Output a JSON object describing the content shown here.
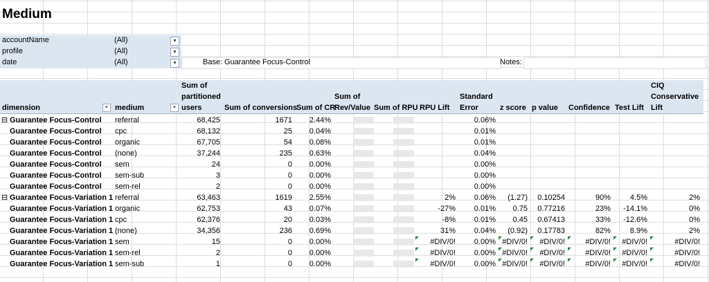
{
  "sheet_title": "Medium",
  "filters": [
    {
      "name": "accountName",
      "value": "(All)"
    },
    {
      "name": "profile",
      "value": "(All)"
    },
    {
      "name": "date",
      "value": "(All)"
    }
  ],
  "base": {
    "label": "Base:",
    "value": "Guarantee Focus-Control"
  },
  "notes": {
    "label": "Notes:"
  },
  "headers": {
    "dimension": "dimension",
    "medium": "medium",
    "users_l1": "Sum of",
    "users_l2": "partitioned",
    "users_l3": "users",
    "conversions": "Sum of conversions",
    "cr": "Sum of CR",
    "rev_l1": "Sum of",
    "rev_l2": "Rev/Value",
    "rpu": "Sum of RPU",
    "rpulift": "RPU Lift",
    "se_l1": "Standard",
    "se_l2": "Error",
    "z": "z score",
    "p": "p value",
    "conf": "Confidence",
    "lift": "Test Lift",
    "ciq_l1": "CIQ",
    "ciq_l2": "Conservative",
    "ciq_l3": "Lift"
  },
  "rows": [
    {
      "dim": "Guarantee Focus-Control",
      "expand": "⊟",
      "medium": "referral",
      "users": "68,425",
      "conv": "1671",
      "cr": "2.44%",
      "rpulift": "",
      "se": "0.06%",
      "z": "",
      "p": "",
      "conf": "",
      "lift": "",
      "ciq": ""
    },
    {
      "dim": "Guarantee Focus-Control",
      "expand": "",
      "medium": "cpc",
      "users": "68,132",
      "conv": "25",
      "cr": "0.04%",
      "rpulift": "",
      "se": "0.01%",
      "z": "",
      "p": "",
      "conf": "",
      "lift": "",
      "ciq": ""
    },
    {
      "dim": "Guarantee Focus-Control",
      "expand": "",
      "medium": "organic",
      "users": "67,705",
      "conv": "54",
      "cr": "0.08%",
      "rpulift": "",
      "se": "0.01%",
      "z": "",
      "p": "",
      "conf": "",
      "lift": "",
      "ciq": ""
    },
    {
      "dim": "Guarantee Focus-Control",
      "expand": "",
      "medium": "(none)",
      "users": "37,244",
      "conv": "235",
      "cr": "0.63%",
      "rpulift": "",
      "se": "0.04%",
      "z": "",
      "p": "",
      "conf": "",
      "lift": "",
      "ciq": ""
    },
    {
      "dim": "Guarantee Focus-Control",
      "expand": "",
      "medium": "sem",
      "users": "24",
      "conv": "0",
      "cr": "0.00%",
      "rpulift": "",
      "se": "0.00%",
      "z": "",
      "p": "",
      "conf": "",
      "lift": "",
      "ciq": ""
    },
    {
      "dim": "Guarantee Focus-Control",
      "expand": "",
      "medium": "sem-sub",
      "users": "3",
      "conv": "0",
      "cr": "0.00%",
      "rpulift": "",
      "se": "0.00%",
      "z": "",
      "p": "",
      "conf": "",
      "lift": "",
      "ciq": ""
    },
    {
      "dim": "Guarantee Focus-Control",
      "expand": "",
      "medium": "sem-rel",
      "users": "2",
      "conv": "0",
      "cr": "0.00%",
      "rpulift": "",
      "se": "0.00%",
      "z": "",
      "p": "",
      "conf": "",
      "lift": "",
      "ciq": ""
    },
    {
      "dim": "Guarantee Focus-Variation 1",
      "expand": "⊟",
      "medium": "referral",
      "users": "63,463",
      "conv": "1619",
      "cr": "2.55%",
      "rpulift": "2%",
      "se": "0.06%",
      "z": "(1.27)",
      "p": "0.10254",
      "conf": "90%",
      "lift": "4.5%",
      "ciq": "2%"
    },
    {
      "dim": "Guarantee Focus-Variation 1",
      "expand": "",
      "medium": "organic",
      "users": "62,753",
      "conv": "43",
      "cr": "0.07%",
      "rpulift": "-27%",
      "se": "0.01%",
      "z": "0.75",
      "p": "0.77216",
      "conf": "23%",
      "lift": "-14.1%",
      "ciq": "0%"
    },
    {
      "dim": "Guarantee Focus-Variation 1",
      "expand": "",
      "medium": "cpc",
      "users": "62,376",
      "conv": "20",
      "cr": "0.03%",
      "rpulift": "-8%",
      "se": "0.01%",
      "z": "0.45",
      "p": "0.67413",
      "conf": "33%",
      "lift": "-12.6%",
      "ciq": "0%"
    },
    {
      "dim": "Guarantee Focus-Variation 1",
      "expand": "",
      "medium": "(none)",
      "users": "34,356",
      "conv": "236",
      "cr": "0.69%",
      "rpulift": "31%",
      "se": "0.04%",
      "z": "(0.92)",
      "p": "0.17783",
      "conf": "82%",
      "lift": "8.9%",
      "ciq": "2%"
    },
    {
      "dim": "Guarantee Focus-Variation 1",
      "expand": "",
      "medium": "sem",
      "users": "15",
      "conv": "0",
      "cr": "0.00%",
      "rpulift": "#DIV/0!",
      "se": "0.00%",
      "z": "#DIV/0!",
      "p": "#DIV/0!",
      "conf": "#DIV/0!",
      "lift": "#DIV/0!",
      "ciq": "#DIV/0!"
    },
    {
      "dim": "Guarantee Focus-Variation 1",
      "expand": "",
      "medium": "sem-rel",
      "users": "2",
      "conv": "0",
      "cr": "0.00%",
      "rpulift": "#DIV/0!",
      "se": "0.00%",
      "z": "#DIV/0!",
      "p": "#DIV/0!",
      "conf": "#DIV/0!",
      "lift": "#DIV/0!",
      "ciq": "#DIV/0!"
    },
    {
      "dim": "Guarantee Focus-Variation 1",
      "expand": "",
      "medium": "sem-sub",
      "users": "1",
      "conv": "0",
      "cr": "0.00%",
      "rpulift": "#DIV/0!",
      "se": "0.00%",
      "z": "#DIV/0!",
      "p": "#DIV/0!",
      "conf": "#DIV/0!",
      "lift": "#DIV/0!",
      "ciq": "#DIV/0!"
    }
  ]
}
